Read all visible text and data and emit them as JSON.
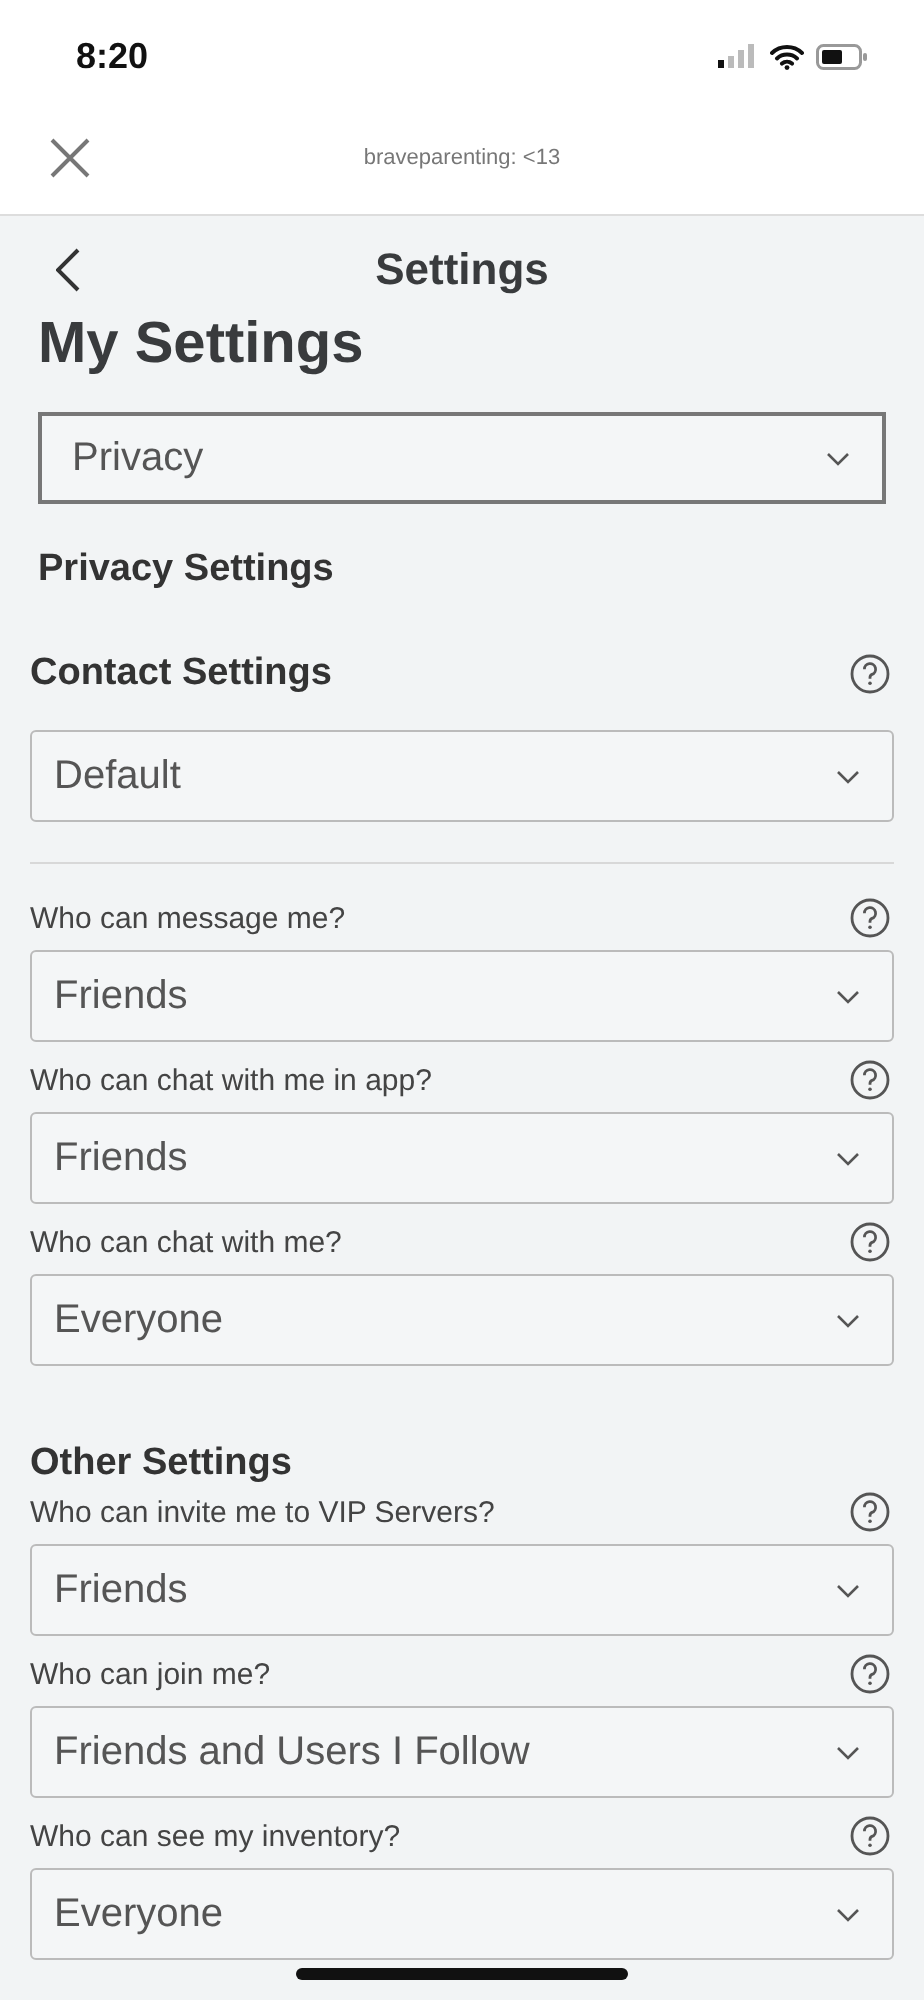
{
  "status_bar": {
    "time": "8:20"
  },
  "top_bar": {
    "title": "braveparenting: <13"
  },
  "header": {
    "title": "Settings"
  },
  "page_title": "My Settings",
  "category_select": {
    "value": "Privacy"
  },
  "section_title": "Privacy Settings",
  "sections": [
    {
      "title": "Contact Settings",
      "help": true,
      "select": "Default",
      "fields": [
        {
          "label": "Who can message me?",
          "help": true,
          "value": "Friends"
        },
        {
          "label": "Who can chat with me in app?",
          "help": true,
          "value": "Friends"
        },
        {
          "label": "Who can chat with me?",
          "help": true,
          "value": "Everyone"
        }
      ]
    },
    {
      "title": "Other Settings",
      "help": false,
      "fields": [
        {
          "label": "Who can invite me to VIP Servers?",
          "help": true,
          "value": "Friends"
        },
        {
          "label": "Who can join me?",
          "help": true,
          "value": "Friends and Users I Follow"
        },
        {
          "label": "Who can see my inventory?",
          "help": true,
          "value": "Everyone"
        }
      ]
    }
  ]
}
